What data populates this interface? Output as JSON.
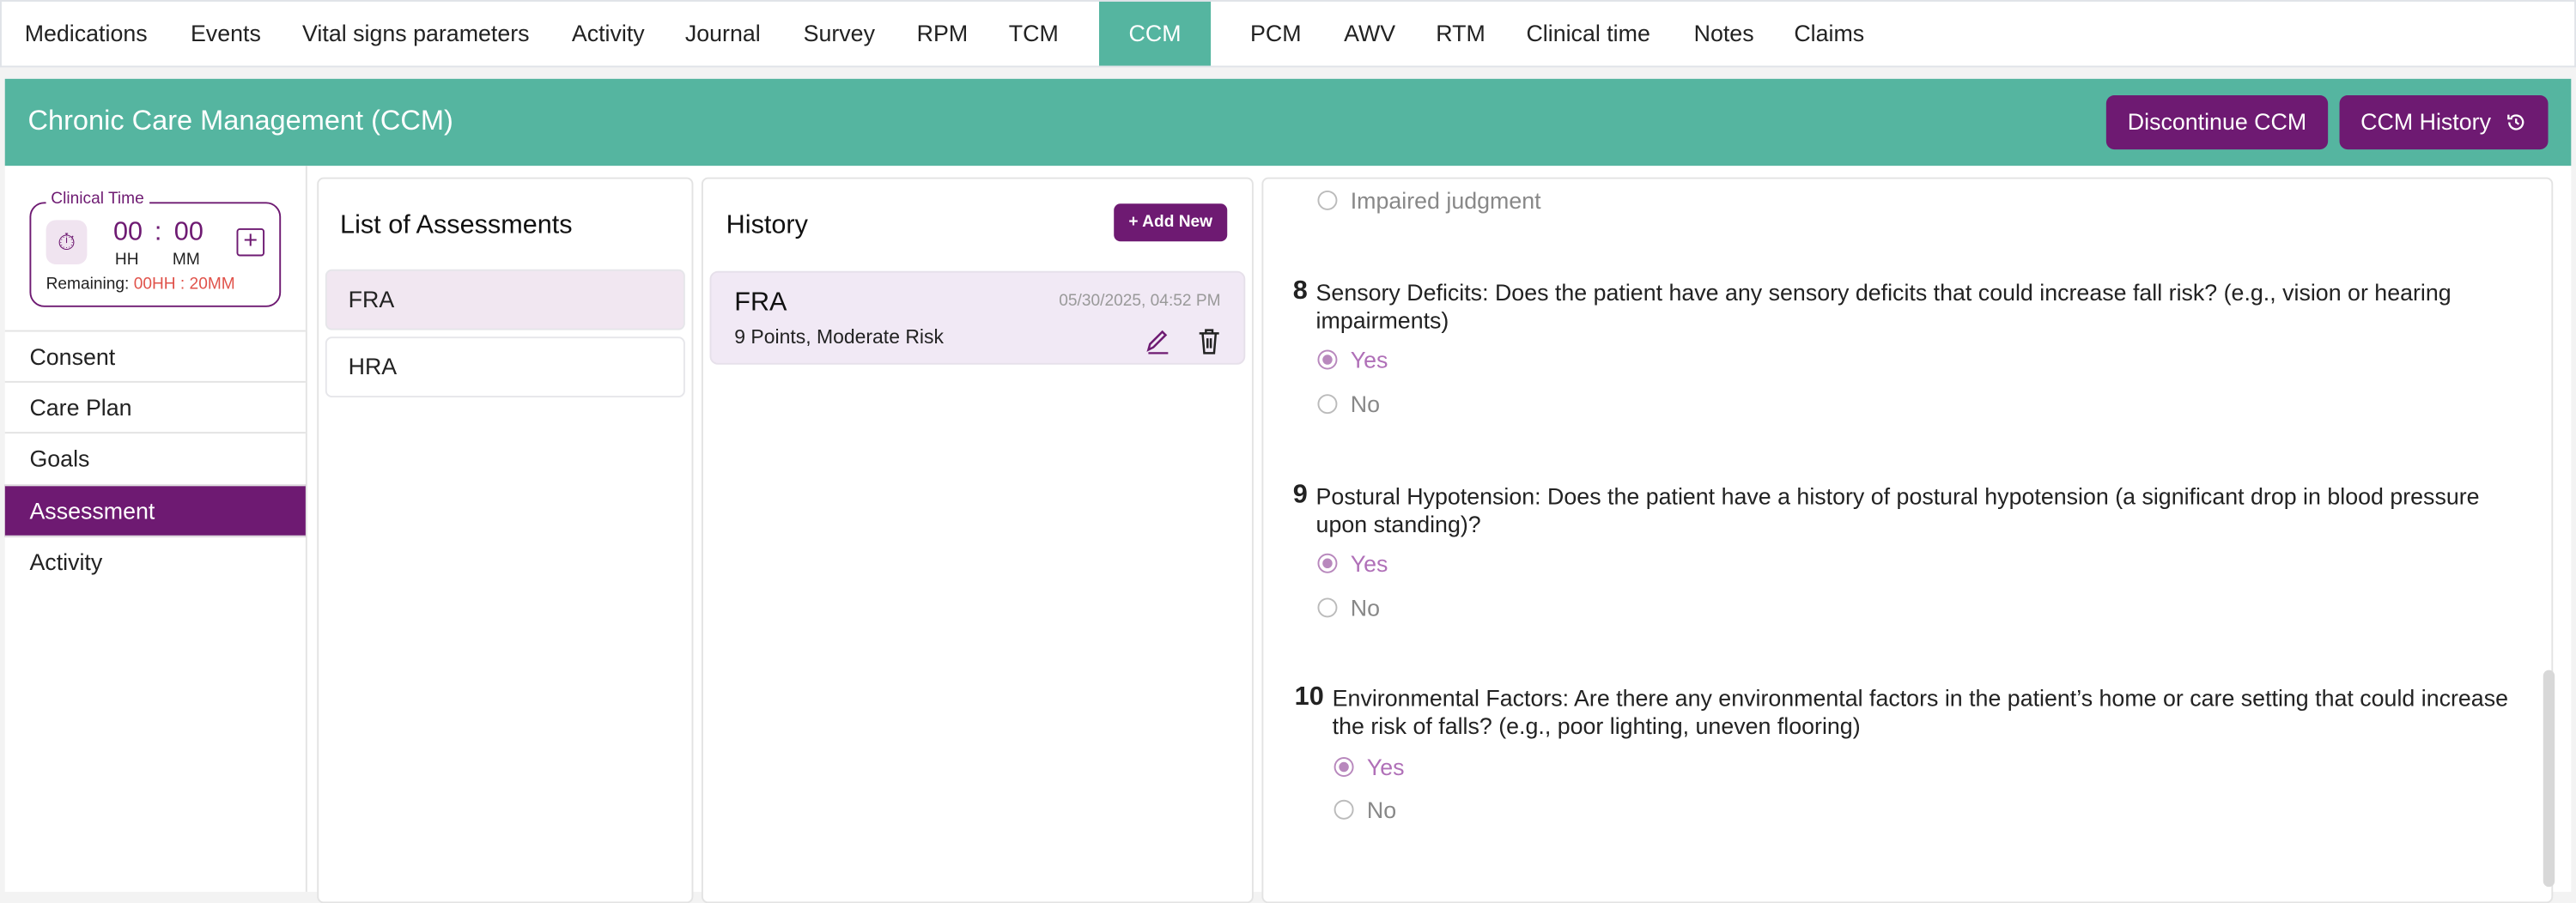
{
  "tabs": [
    "Medications",
    "Events",
    "Vital signs parameters",
    "Activity",
    "Journal",
    "Survey",
    "RPM",
    "TCM",
    "CCM",
    "PCM",
    "AWV",
    "RTM",
    "Clinical time",
    "Notes",
    "Claims"
  ],
  "active_tab": "CCM",
  "header": {
    "title": "Chronic Care Management (CCM)",
    "discontinue_label": "Discontinue CCM",
    "history_label": "CCM History",
    "history_icon": "history-icon"
  },
  "clinical_time": {
    "label": "Clinical Time",
    "hh": "00",
    "sep": ":",
    "mm": "00",
    "hh_label": "HH",
    "mm_label": "MM",
    "remaining_label": "Remaining:",
    "remaining_value": "00HH : 20MM"
  },
  "sidebar": {
    "items": [
      "Consent",
      "Care Plan",
      "Goals",
      "Assessment",
      "Activity"
    ],
    "active": "Assessment"
  },
  "assessments": {
    "title": "List of Assessments",
    "items": [
      "FRA",
      "HRA"
    ],
    "selected": "FRA"
  },
  "history": {
    "title": "History",
    "add_label": "+ Add New",
    "entries": [
      {
        "name": "FRA",
        "date": "05/30/2025, 04:52 PM",
        "summary": "9 Points, Moderate Risk"
      }
    ]
  },
  "questions": {
    "prev_option": "Impaired judgment",
    "items": [
      {
        "number": "8",
        "text": "Sensory Deficits: Does the patient have any sensory deficits that could increase fall risk? (e.g., vision or hearing impairments)",
        "options": [
          "Yes",
          "No"
        ],
        "selected": "Yes"
      },
      {
        "number": "9",
        "text": "Postural Hypotension: Does the patient have a history of postural hypotension (a significant drop in blood pressure upon standing)?",
        "options": [
          "Yes",
          "No"
        ],
        "selected": "Yes"
      },
      {
        "number": "10",
        "text": "Environmental Factors: Are there any environmental factors in the patient’s home or care setting that could increase the risk of falls? (e.g., poor lighting, uneven flooring)",
        "options": [
          "Yes",
          "No"
        ],
        "selected": "Yes"
      }
    ]
  },
  "colors": {
    "teal": "#55b5a0",
    "purple": "#6e1a72",
    "remaining": "#e0524a",
    "selected_radio": "#b888bd"
  }
}
